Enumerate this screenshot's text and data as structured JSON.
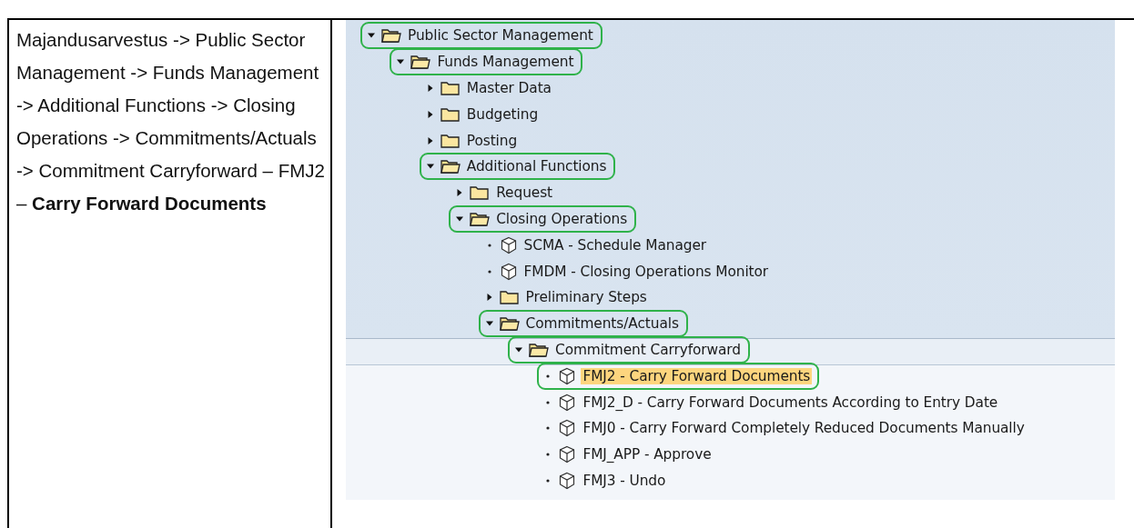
{
  "table": {
    "path_text": "Majandusarvestus -> Public Sector Management -> Funds Management -> Additional Functions -> Closing Operations -> Commitments/Actuals  -> Commitment Carryforward – FMJ2 – **Carry Forward Documents**",
    "tree": [
      {
        "label": "Public Sector Management",
        "kind": "folder",
        "expanded": true,
        "marked": true,
        "selected": false,
        "children": [
          {
            "label": "Funds Management",
            "kind": "folder",
            "expanded": true,
            "marked": true,
            "selected": false,
            "children": [
              {
                "label": "Master Data",
                "kind": "folder",
                "expanded": false,
                "marked": false,
                "selected": false
              },
              {
                "label": "Budgeting",
                "kind": "folder",
                "expanded": false,
                "marked": false,
                "selected": false
              },
              {
                "label": "Posting",
                "kind": "folder",
                "expanded": false,
                "marked": false,
                "selected": false
              },
              {
                "label": "Additional Functions",
                "kind": "folder",
                "expanded": true,
                "marked": true,
                "selected": false,
                "children": [
                  {
                    "label": "Request",
                    "kind": "folder",
                    "expanded": false,
                    "marked": false,
                    "selected": false
                  },
                  {
                    "label": "Closing Operations",
                    "kind": "folder",
                    "expanded": true,
                    "marked": true,
                    "selected": false,
                    "children": [
                      {
                        "label": "SCMA - Schedule Manager",
                        "kind": "transaction",
                        "marked": false,
                        "selected": false
                      },
                      {
                        "label": "FMDM - Closing Operations Monitor",
                        "kind": "transaction",
                        "marked": false,
                        "selected": false
                      },
                      {
                        "label": "Preliminary Steps",
                        "kind": "folder",
                        "expanded": false,
                        "marked": false,
                        "selected": false
                      },
                      {
                        "label": "Commitments/Actuals",
                        "kind": "folder",
                        "expanded": true,
                        "marked": true,
                        "selected": false,
                        "children": [
                          {
                            "label": "Commitment Carryforward",
                            "kind": "folder",
                            "expanded": true,
                            "marked": true,
                            "selected": false,
                            "children": [
                              {
                                "label": "FMJ2 - Carry Forward Documents",
                                "kind": "transaction",
                                "marked": true,
                                "selected": true
                              },
                              {
                                "label": "FMJ2_D - Carry Forward Documents According to Entry Date",
                                "kind": "transaction",
                                "marked": false,
                                "selected": false
                              },
                              {
                                "label": "FMJ0 - Carry Forward Completely Reduced Documents Manually",
                                "kind": "transaction",
                                "marked": false,
                                "selected": false
                              },
                              {
                                "label": "FMJ_APP - Approve",
                                "kind": "transaction",
                                "marked": false,
                                "selected": false
                              },
                              {
                                "label": "FMJ3 - Undo",
                                "kind": "transaction",
                                "marked": false,
                                "selected": false
                              }
                            ]
                          }
                        ]
                      }
                    ]
                  }
                ]
              }
            ]
          }
        ]
      }
    ]
  }
}
